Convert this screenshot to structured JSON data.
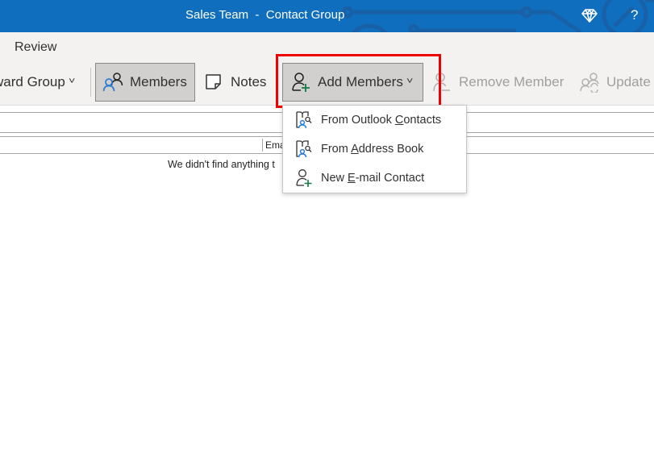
{
  "titlebar": {
    "title": "Sales Team  -  Contact Group",
    "icons": [
      "diamond-icon",
      "help-icon"
    ],
    "help_label": "?"
  },
  "ribbon": {
    "tabs": [
      {
        "label": "Review"
      }
    ],
    "commands": {
      "forward_group": {
        "label": "ward Group",
        "has_dropdown": true
      },
      "members": {
        "label": "Members",
        "state": "pressed",
        "icon": "members-icon"
      },
      "notes": {
        "label": "Notes",
        "icon": "note-icon"
      },
      "add_members": {
        "label": "Add Members",
        "state": "pressed",
        "has_dropdown": true,
        "icon": "add-person-icon",
        "highlighted": true
      },
      "remove_member": {
        "label": "Remove Member",
        "state": "disabled",
        "icon": "remove-person-icon"
      },
      "update": {
        "label": "Update",
        "state": "disabled",
        "icon": "update-members-icon"
      }
    }
  },
  "add_members_menu": {
    "items": [
      {
        "pre": "From Outlook ",
        "accel": "C",
        "post": "ontacts",
        "icon": "address-book-icon"
      },
      {
        "pre": "From ",
        "accel": "A",
        "post": "ddress Book",
        "icon": "address-book-icon"
      },
      {
        "pre": "New ",
        "accel": "E",
        "post": "-mail Contact",
        "icon": "add-person-icon"
      }
    ]
  },
  "list": {
    "columns": [
      {
        "label": "Ema"
      }
    ],
    "empty_message": "We didn't find anything t"
  },
  "colors": {
    "titlebar": "#106ebe",
    "ribbon_bg": "#f3f2f1",
    "pressed_bg": "#d2d0ce",
    "highlight": "#ee0000",
    "add_plus": "#107c41",
    "person_blue": "#2b7cd3"
  }
}
